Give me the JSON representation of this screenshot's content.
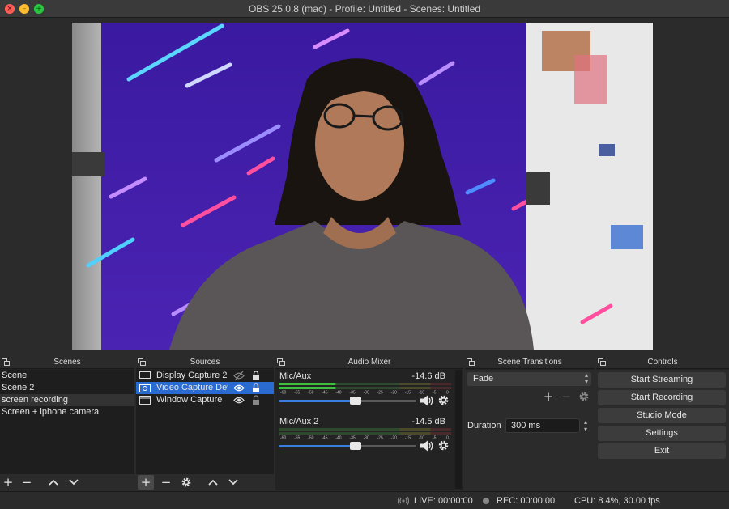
{
  "window": {
    "title": "OBS 25.0.8 (mac) - Profile: Untitled - Scenes: Untitled"
  },
  "docks": {
    "scenes": {
      "title": "Scenes",
      "items": [
        "Scene",
        "Scene 2",
        "screen recording",
        "Screen + iphone camera"
      ],
      "selected": "screen recording"
    },
    "sources": {
      "title": "Sources",
      "items": [
        {
          "label": "Display Capture 2",
          "icon": "monitor-icon",
          "visible": false,
          "locked": true
        },
        {
          "label": "Video Capture Device",
          "icon": "camera-icon",
          "visible": true,
          "locked": true
        },
        {
          "label": "Window Capture",
          "icon": "window-icon",
          "visible": true,
          "locked": false
        }
      ],
      "selected": "Video Capture Device"
    },
    "mixer": {
      "title": "Audio Mixer",
      "scale": [
        "-60",
        "-55",
        "-50",
        "-45",
        "-40",
        "-35",
        "-30",
        "-25",
        "-20",
        "-15",
        "-10",
        "-5",
        "0"
      ],
      "channels": [
        {
          "name": "Mic/Aux",
          "db": "-14.6 dB",
          "volume": 0.56,
          "level": 0.33
        },
        {
          "name": "Mic/Aux 2",
          "db": "-14.5 dB",
          "volume": 0.56,
          "level": 0.0
        }
      ]
    },
    "transitions": {
      "title": "Scene Transitions",
      "selected": "Fade",
      "duration_label": "Duration",
      "duration": "300 ms"
    },
    "controls": {
      "title": "Controls",
      "buttons": [
        "Start Streaming",
        "Start Recording",
        "Studio Mode",
        "Settings",
        "Exit"
      ]
    }
  },
  "status": {
    "live": "LIVE: 00:00:00",
    "rec": "REC: 00:00:00",
    "cpu": "CPU: 8.4%, 30.00 fps"
  },
  "colors": {
    "accent": "#2a6bd1",
    "meter_green": "#3fbf3f",
    "meter_yellow": "#c8c83a",
    "meter_red": "#c84040"
  }
}
